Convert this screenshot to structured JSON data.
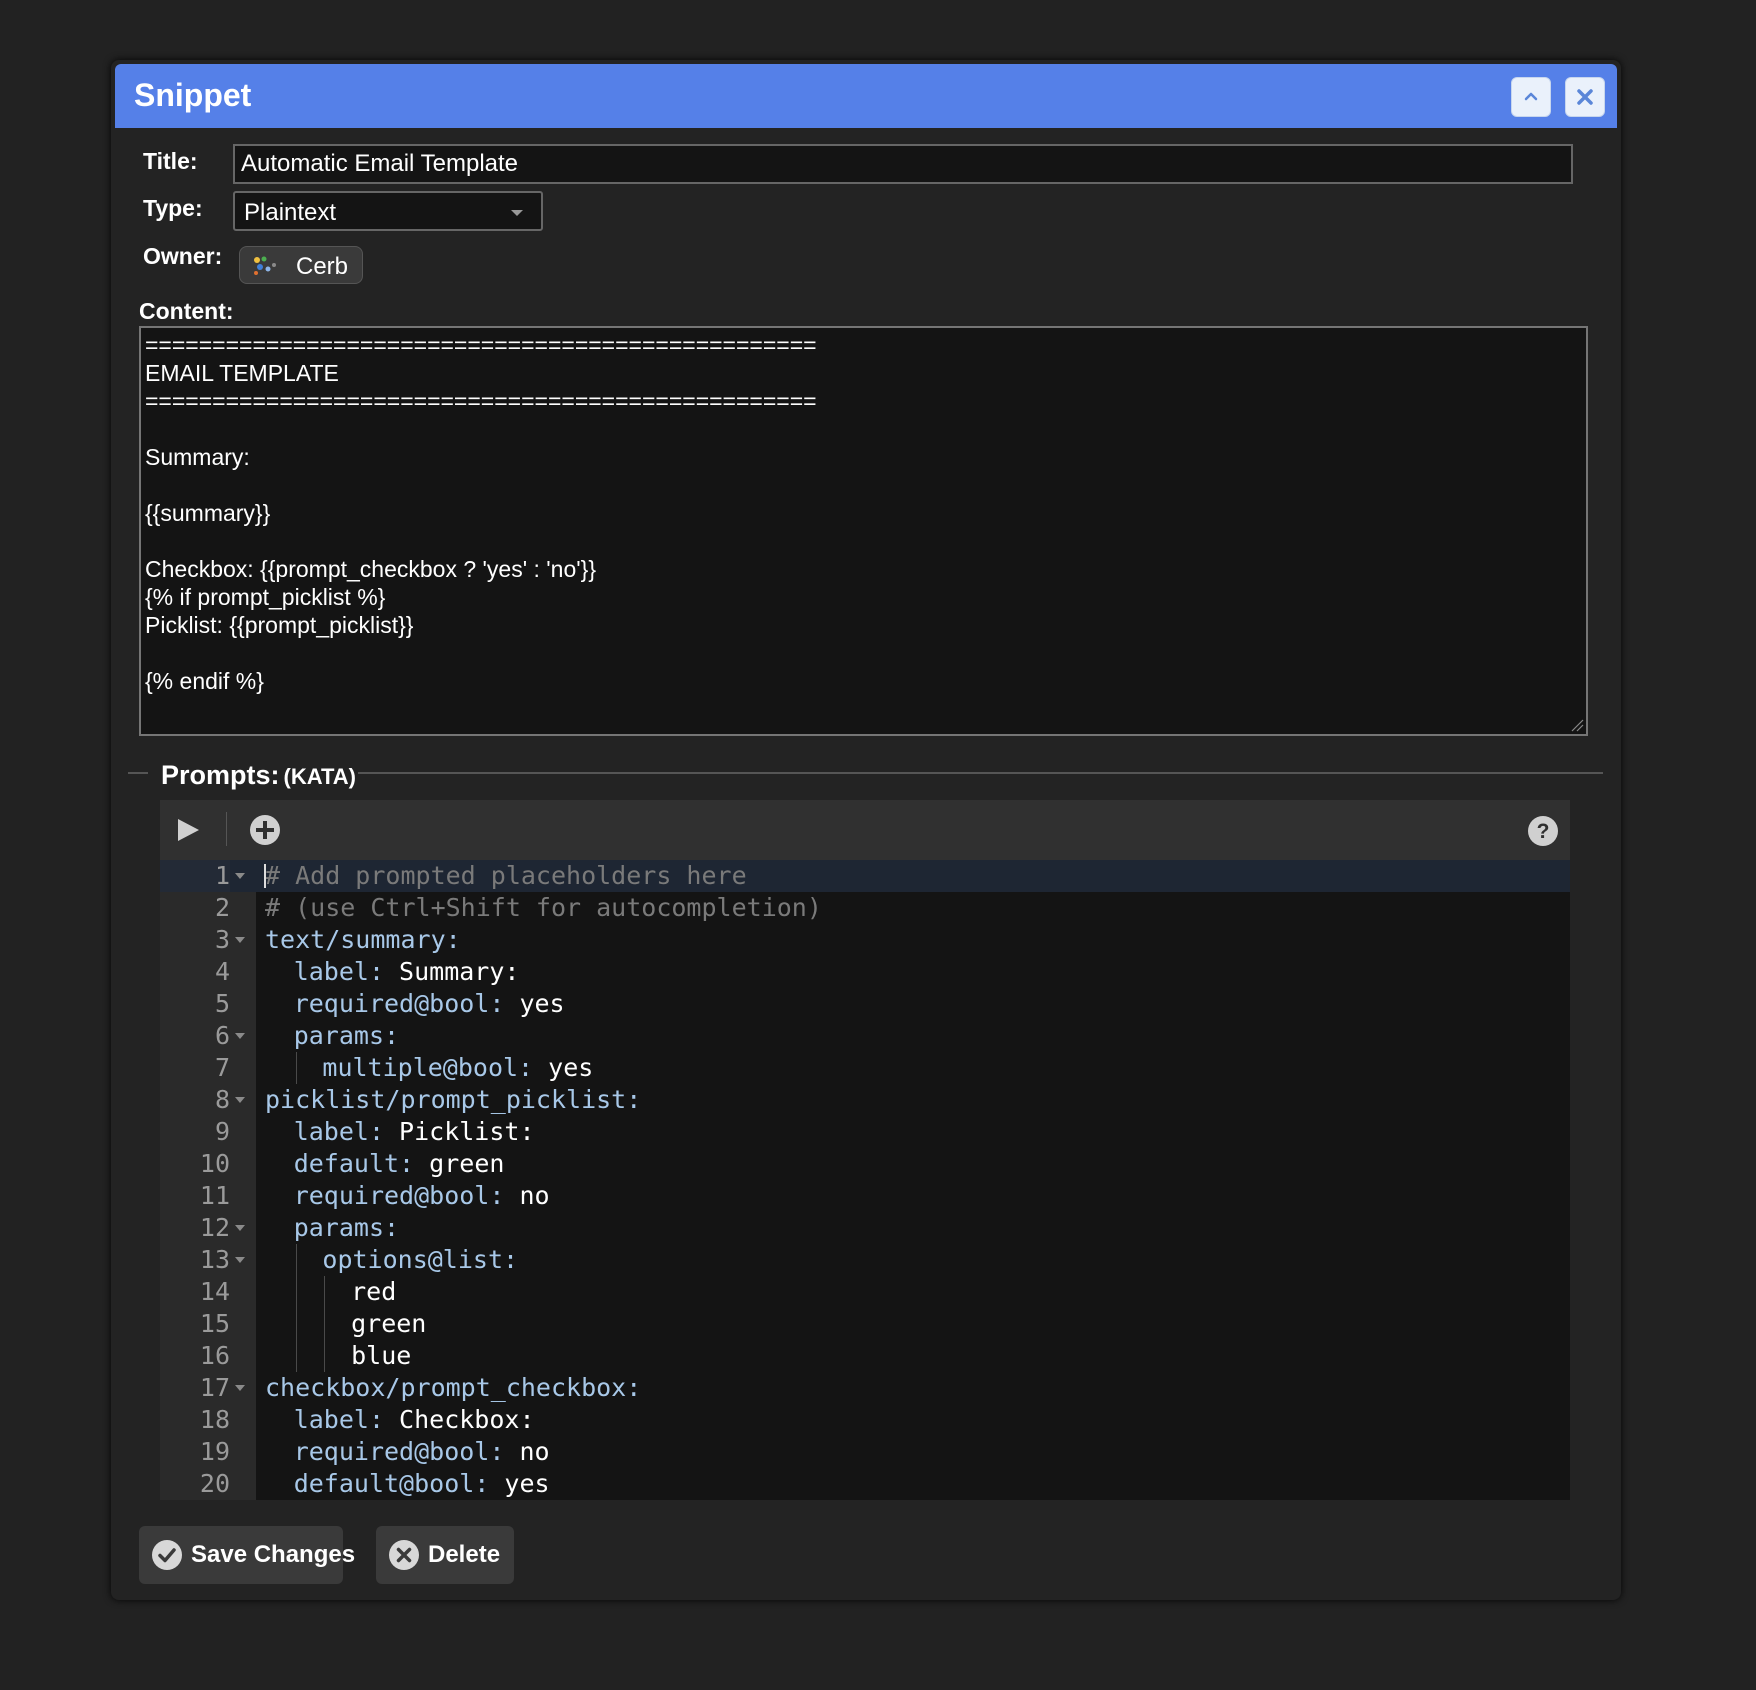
{
  "dialog": {
    "title": "Snippet",
    "collapse_icon": "chevron-up-icon",
    "close_icon": "close-icon",
    "accent_color": "#5580e8"
  },
  "form": {
    "title_label": "Title:",
    "title_value": "Automatic Email Template",
    "type_label": "Type:",
    "type_value": "Plaintext",
    "owner_label": "Owner:",
    "owner_name": "Cerb",
    "content_label": "Content:"
  },
  "content_lines": [
    "==================================================",
    "EMAIL TEMPLATE",
    "==================================================",
    "",
    "Summary:",
    "",
    "{{summary}}",
    "",
    "Checkbox: {{prompt_checkbox ? 'yes' : 'no'}}",
    "{% if prompt_picklist %}",
    "Picklist: {{prompt_picklist}}",
    "",
    "{% endif %}"
  ],
  "prompts": {
    "label": "Prompts:",
    "sublabel": "(KATA)",
    "run_icon": "play-icon",
    "add_icon": "plus-circle-icon",
    "help_icon": "help-icon"
  },
  "code_lines": [
    {
      "n": "1",
      "fold": true,
      "indent": 0,
      "key": "",
      "val": "",
      "comment": "# Add prompted placeholders here"
    },
    {
      "n": "2",
      "fold": false,
      "indent": 0,
      "key": "",
      "val": "",
      "comment": "# (use Ctrl+Shift for autocompletion)"
    },
    {
      "n": "3",
      "fold": true,
      "indent": 0,
      "key": "text/summary:",
      "val": "",
      "comment": ""
    },
    {
      "n": "4",
      "fold": false,
      "indent": 1,
      "key": "label:",
      "val": " Summary:",
      "comment": ""
    },
    {
      "n": "5",
      "fold": false,
      "indent": 1,
      "key": "required@bool:",
      "val": " yes",
      "comment": ""
    },
    {
      "n": "6",
      "fold": true,
      "indent": 1,
      "key": "params:",
      "val": "",
      "comment": ""
    },
    {
      "n": "7",
      "fold": false,
      "indent": 2,
      "key": "multiple@bool:",
      "val": " yes",
      "comment": ""
    },
    {
      "n": "8",
      "fold": true,
      "indent": 0,
      "key": "picklist/prompt_picklist:",
      "val": "",
      "comment": ""
    },
    {
      "n": "9",
      "fold": false,
      "indent": 1,
      "key": "label:",
      "val": " Picklist:",
      "comment": ""
    },
    {
      "n": "10",
      "fold": false,
      "indent": 1,
      "key": "default:",
      "val": " green",
      "comment": ""
    },
    {
      "n": "11",
      "fold": false,
      "indent": 1,
      "key": "required@bool:",
      "val": " no",
      "comment": ""
    },
    {
      "n": "12",
      "fold": true,
      "indent": 1,
      "key": "params:",
      "val": "",
      "comment": ""
    },
    {
      "n": "13",
      "fold": true,
      "indent": 2,
      "key": "options@list:",
      "val": "",
      "comment": ""
    },
    {
      "n": "14",
      "fold": false,
      "indent": 3,
      "key": "",
      "val": "red",
      "comment": ""
    },
    {
      "n": "15",
      "fold": false,
      "indent": 3,
      "key": "",
      "val": "green",
      "comment": ""
    },
    {
      "n": "16",
      "fold": false,
      "indent": 3,
      "key": "",
      "val": "blue",
      "comment": ""
    },
    {
      "n": "17",
      "fold": true,
      "indent": 0,
      "key": "checkbox/prompt_checkbox:",
      "val": "",
      "comment": ""
    },
    {
      "n": "18",
      "fold": false,
      "indent": 1,
      "key": "label:",
      "val": " Checkbox:",
      "comment": ""
    },
    {
      "n": "19",
      "fold": false,
      "indent": 1,
      "key": "required@bool:",
      "val": " no",
      "comment": ""
    },
    {
      "n": "20",
      "fold": false,
      "indent": 1,
      "key": "default@bool:",
      "val": " yes",
      "comment": ""
    }
  ],
  "buttons": {
    "save_label": "Save Changes",
    "save_icon": "checkmark-circle-icon",
    "delete_label": "Delete",
    "delete_icon": "x-circle-icon"
  }
}
